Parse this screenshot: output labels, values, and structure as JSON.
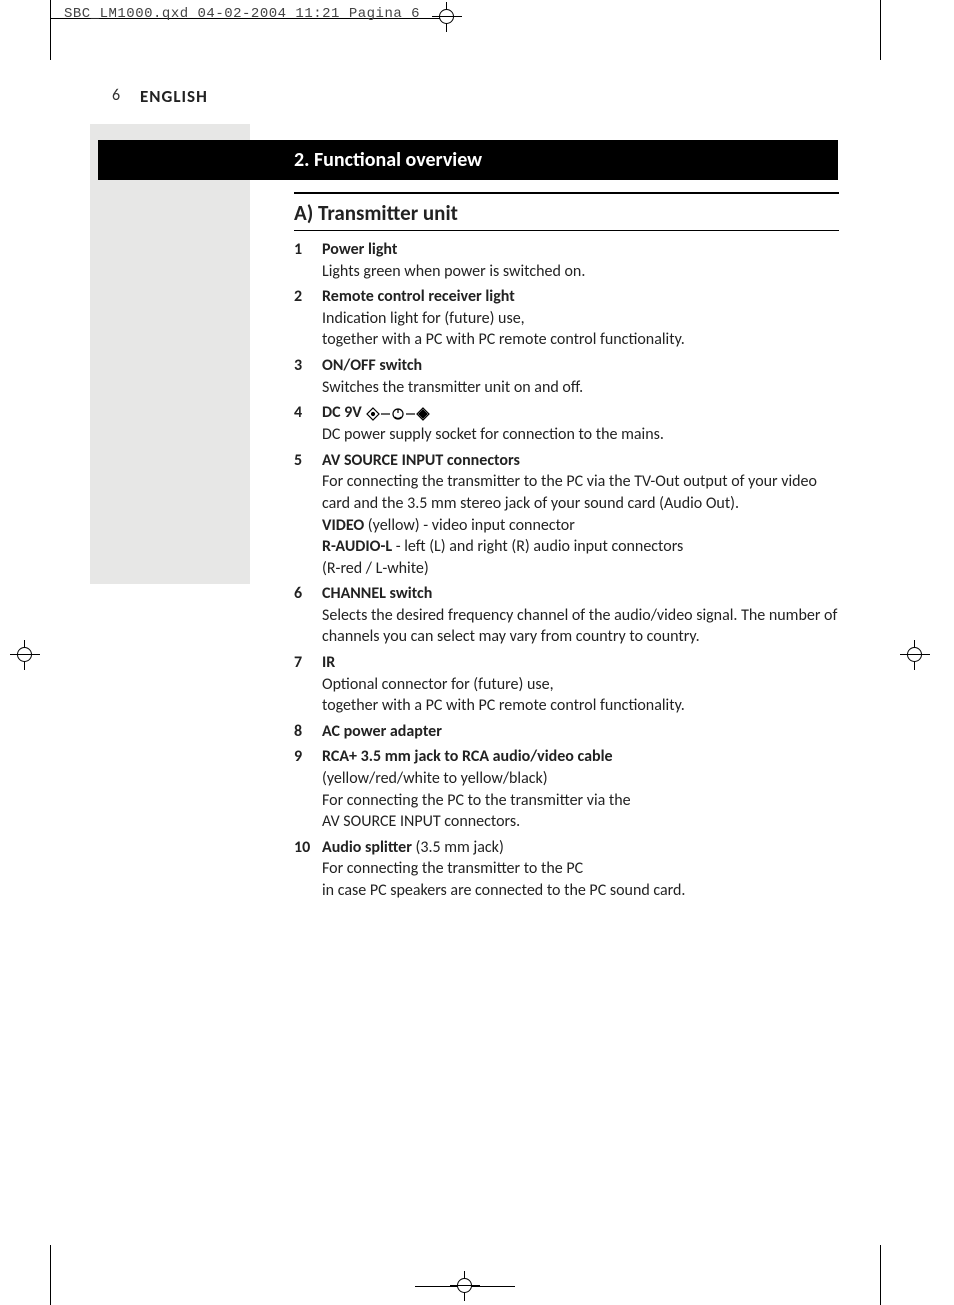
{
  "header": {
    "slug": "SBC_LM1000.qxd  04-02-2004  11:21  Pagina 6"
  },
  "page": {
    "number": "6",
    "language": "ENGLISH"
  },
  "section": {
    "banner": "2. Functional overview",
    "subtitle": "A) Transmitter unit",
    "items": [
      {
        "num": "1",
        "title": "Power light",
        "desc": "Lights green when power is switched on."
      },
      {
        "num": "2",
        "title": "Remote control receiver light",
        "desc": "Indication light for (future) use,\ntogether with a PC with PC remote control functionality."
      },
      {
        "num": "3",
        "title": "ON/OFF switch",
        "desc": "Switches the transmitter unit on and off."
      },
      {
        "num": "4",
        "title": "DC 9V",
        "icon": "dc-polarity-icon",
        "desc": "DC power supply socket for connection to the mains."
      },
      {
        "num": "5",
        "title": "AV SOURCE INPUT connectors",
        "desc": "For connecting the transmitter to the PC via the TV-Out output of your video card and the 3.5 mm stereo jack of your sound card (Audio Out).",
        "extra": [
          {
            "bold": "VIDEO",
            "rest": " (yellow) - video input connector"
          },
          {
            "bold": "R-AUDIO-L",
            "rest": " - left (L) and right (R) audio input connectors"
          },
          {
            "bold": "",
            "rest": "(R-red / L-white)"
          }
        ]
      },
      {
        "num": "6",
        "title": "CHANNEL switch",
        "desc": "Selects the desired frequency channel of the audio/video signal. The number of channels you can select may vary from country to country."
      },
      {
        "num": "7",
        "title": "IR",
        "desc": "Optional connector for (future) use,\ntogether with a PC with PC remote control functionality."
      },
      {
        "num": "8",
        "title": "AC power adapter",
        "desc": ""
      },
      {
        "num": "9",
        "title": "RCA+ 3.5 mm jack to RCA audio/video cable",
        "desc": "(yellow/red/white to yellow/black)\nFor connecting the PC to the transmitter via the\nAV SOURCE INPUT connectors."
      },
      {
        "num": "10",
        "title_inline": "Audio splitter",
        "title_rest": " (3.5 mm jack)",
        "desc": "For connecting the transmitter to the PC\nin case PC speakers are connected to the PC sound card."
      }
    ]
  }
}
